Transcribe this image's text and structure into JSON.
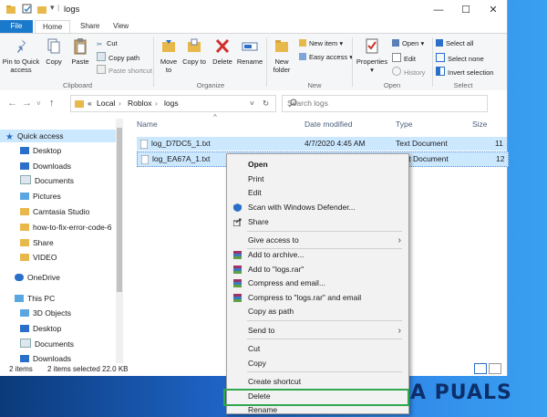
{
  "window": {
    "title": "logs",
    "controls": {
      "minimize": "—",
      "maximize": "☐",
      "close": "✕"
    }
  },
  "tabs": {
    "file": "File",
    "home": "Home",
    "share": "Share",
    "view": "View"
  },
  "ribbon": {
    "clipboard": {
      "pin": "Pin to Quick access",
      "copy": "Copy",
      "paste": "Paste",
      "cut": "Cut",
      "copy_path": "Copy path",
      "paste_shortcut": "Paste shortcut",
      "group": "Clipboard"
    },
    "organize": {
      "move_to": "Move to",
      "copy_to": "Copy to",
      "delete": "Delete",
      "rename": "Rename",
      "group": "Organize"
    },
    "new": {
      "new_folder": "New folder",
      "new_item": "New item",
      "easy_access": "Easy access",
      "group": "New"
    },
    "open": {
      "properties": "Properties",
      "open": "Open",
      "edit": "Edit",
      "history": "History",
      "group": "Open"
    },
    "select": {
      "select_all": "Select all",
      "select_none": "Select none",
      "invert": "Invert selection",
      "group": "Select"
    }
  },
  "address": {
    "path": [
      "«",
      "Local",
      "›",
      "Roblox",
      "›",
      "logs"
    ],
    "search_placeholder": "Search logs"
  },
  "nav": {
    "quick_access": "Quick access",
    "items": [
      "Desktop",
      "Downloads",
      "Documents",
      "Pictures",
      "Camtasia Studio",
      "how-to-fix-error-code-6",
      "Share",
      "VIDEO"
    ],
    "onedrive": "OneDrive",
    "this_pc": "This PC",
    "pc_items": [
      "3D Objects",
      "Desktop",
      "Documents",
      "Downloads"
    ]
  },
  "columns": {
    "name": "Name",
    "date": "Date modified",
    "type": "Type",
    "size": "Size"
  },
  "files": [
    {
      "name": "log_D7DC5_1.txt",
      "date": "4/7/2020 4:45 AM",
      "type": "Text Document",
      "size": "11"
    },
    {
      "name": "log_EA67A_1.txt",
      "date": "",
      "type": "Text Document",
      "size": "12"
    }
  ],
  "status": {
    "items": "2 items",
    "selected": "2 items selected  22.0 KB"
  },
  "context_menu": [
    {
      "label": "Open",
      "bold": true,
      "icon": ""
    },
    {
      "label": "Print",
      "icon": ""
    },
    {
      "label": "Edit",
      "icon": ""
    },
    {
      "label": "Scan with Windows Defender...",
      "icon": "defender-icon"
    },
    {
      "label": "Share",
      "icon": "share-icon"
    },
    {
      "label": "Give access to",
      "submenu": true
    },
    {
      "label": "Add to archive...",
      "icon": "winrar-icon"
    },
    {
      "label": "Add to \"logs.rar\"",
      "icon": "winrar-icon"
    },
    {
      "label": "Compress and email...",
      "icon": "winrar-icon"
    },
    {
      "label": "Compress to \"logs.rar\" and email",
      "icon": "winrar-icon"
    },
    {
      "label": "Copy as path"
    },
    {
      "label": "Send to",
      "submenu": true
    },
    {
      "label": "Cut"
    },
    {
      "label": "Copy"
    },
    {
      "label": "Create shortcut"
    },
    {
      "label": "Delete"
    },
    {
      "label": "Rename"
    }
  ],
  "watermark": "A PUALS",
  "colors": {
    "accent": "#1979ca",
    "selection": "#cce8ff",
    "highlight_box": "#2fa84f",
    "folder": "#e8b84a"
  }
}
